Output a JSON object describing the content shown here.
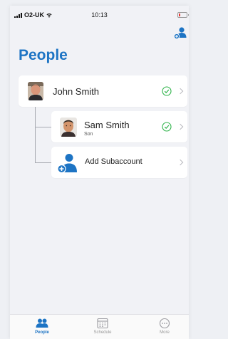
{
  "status_bar": {
    "carrier": "O2-UK",
    "time": "10:13"
  },
  "header": {
    "title": "People",
    "add_person_icon": "person-add-icon"
  },
  "people": [
    {
      "name": "John Smith",
      "relation": "",
      "verified": true
    },
    {
      "name": "Sam Smith",
      "relation": "Son",
      "verified": true
    }
  ],
  "add_subaccount": {
    "label": "Add Subaccount",
    "icon": "person-add-icon"
  },
  "tabs": [
    {
      "label": "People",
      "icon": "people-icon",
      "active": true
    },
    {
      "label": "Schedule",
      "icon": "calendar-icon",
      "active": false
    },
    {
      "label": "More",
      "icon": "more-icon",
      "active": false
    }
  ],
  "colors": {
    "accent": "#1d74c4",
    "verified": "#2fb34a",
    "background": "#f1f2f6"
  }
}
